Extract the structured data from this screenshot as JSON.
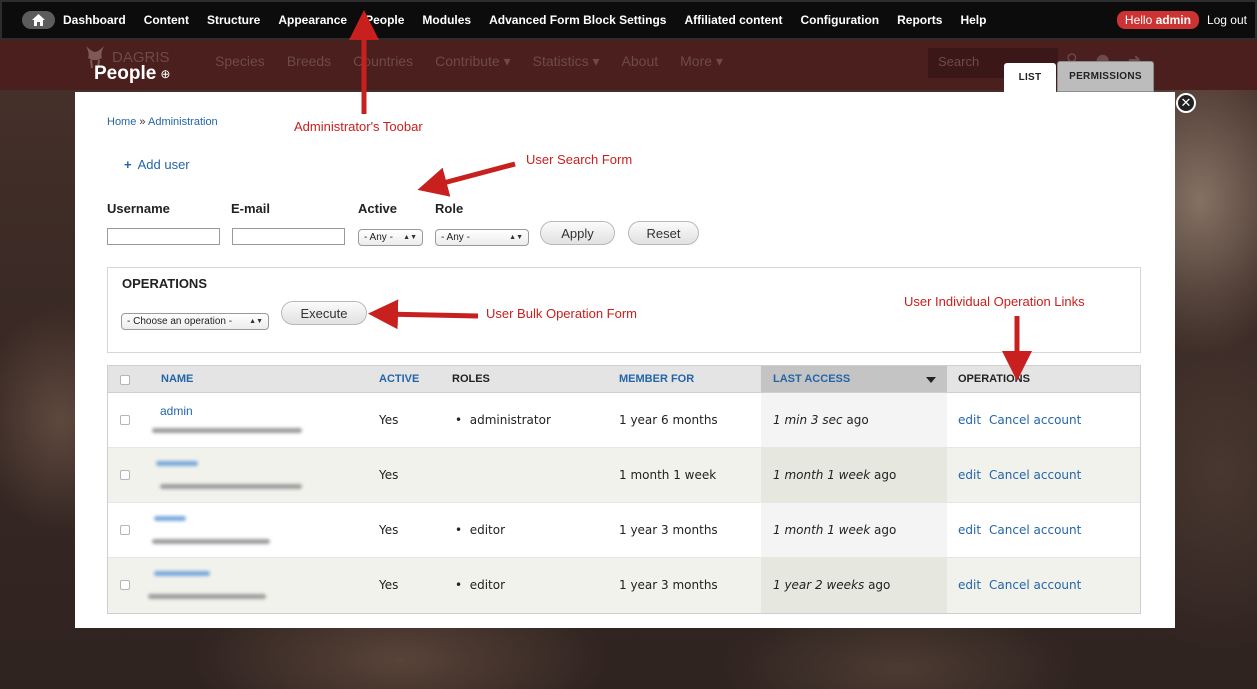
{
  "admin_toolbar": {
    "items": [
      "Dashboard",
      "Content",
      "Structure",
      "Appearance",
      "People",
      "Modules",
      "Advanced Form Block Settings",
      "Affiliated content",
      "Configuration",
      "Reports",
      "Help"
    ],
    "hello_prefix": "Hello",
    "hello_user": "admin",
    "logout": "Log out"
  },
  "site_header": {
    "logo": "DAGRIS",
    "nav": [
      "Species",
      "Breeds",
      "Countries",
      "Contribute ▾",
      "Statistics ▾",
      "About",
      "More ▾"
    ],
    "search_placeholder": "Search"
  },
  "overlay": {
    "title": "People",
    "title_icon": "⊕",
    "tabs": [
      "LIST",
      "PERMISSIONS"
    ],
    "close": "✕"
  },
  "breadcrumb": {
    "home": "Home",
    "sep": "»",
    "admin": "Administration"
  },
  "add_user": {
    "icon": "+",
    "label": "Add user"
  },
  "search_form": {
    "username_label": "Username",
    "email_label": "E-mail",
    "active_label": "Active",
    "role_label": "Role",
    "active_value": "- Any -",
    "role_value": "- Any -",
    "apply": "Apply",
    "reset": "Reset"
  },
  "operations_form": {
    "title": "OPERATIONS",
    "select_value": "- Choose an operation -",
    "execute": "Execute"
  },
  "table": {
    "headers": [
      "NAME",
      "ACTIVE",
      "ROLES",
      "MEMBER FOR",
      "LAST ACCESS",
      "OPERATIONS"
    ],
    "rows": [
      {
        "name": "admin",
        "active": "Yes",
        "role": "administrator",
        "member_for": "1 year 6 months",
        "last_access_em": "1 min 3 sec",
        "last_access_suffix": " ago",
        "edit": "edit",
        "cancel": "Cancel account"
      },
      {
        "name": "",
        "active": "Yes",
        "role": "",
        "member_for": "1 month 1 week",
        "last_access_em": "1 month 1 week",
        "last_access_suffix": " ago",
        "edit": "edit",
        "cancel": "Cancel account"
      },
      {
        "name": "",
        "active": "Yes",
        "role": "editor",
        "member_for": "1 year 3 months",
        "last_access_em": "1 month 1 week",
        "last_access_suffix": " ago",
        "edit": "edit",
        "cancel": "Cancel account"
      },
      {
        "name": "",
        "active": "Yes",
        "role": "editor",
        "member_for": "1 year 3 months",
        "last_access_em": "1 year 2 weeks",
        "last_access_suffix": " ago",
        "edit": "edit",
        "cancel": "Cancel account"
      }
    ]
  },
  "annotations": {
    "toolbar": "Administrator's Toobar",
    "search": "User Search Form",
    "bulk": "User Bulk Operation Form",
    "individual": "User Individual Operation Links"
  },
  "colors": {
    "annotation": "#c8201e",
    "link": "#2465a8",
    "admin_bar": "#0c0c0c",
    "hello_badge": "#cc3333"
  }
}
